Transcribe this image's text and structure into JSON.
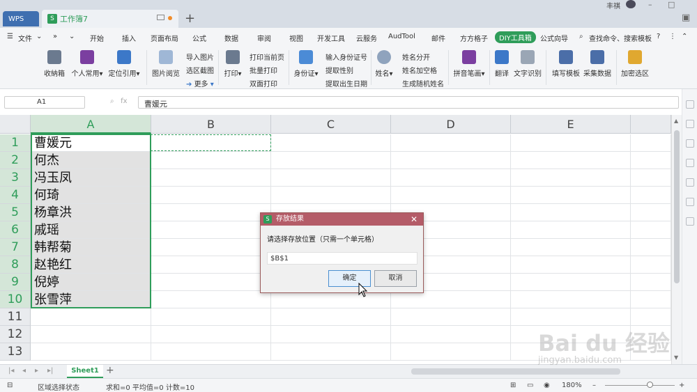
{
  "tabbar": {
    "app_tab": "WPS",
    "doc_tab": "工作簿7",
    "user": "丰祺"
  },
  "menu": [
    "文件",
    "开始",
    "插入",
    "页面布局",
    "公式",
    "数据",
    "审阅",
    "视图",
    "开发工具",
    "云服务",
    "AudTool",
    "邮件",
    "方方格子",
    "DIY工具箱",
    "公式向导"
  ],
  "search": "查找命令、搜索模板",
  "ribbon": {
    "big": [
      {
        "label": "收納箱"
      },
      {
        "label": "个人常用"
      },
      {
        "label": "定位引用"
      },
      {
        "label": "图片阅览"
      },
      {
        "label": "打印"
      },
      {
        "label": "身份证"
      },
      {
        "label": "姓名"
      },
      {
        "label": "拼音笔画"
      },
      {
        "label": "翻译"
      },
      {
        "label": "文字识别"
      },
      {
        "label": "填写模板"
      },
      {
        "label": "采集数据"
      },
      {
        "label": "加密选区"
      }
    ],
    "small": [
      "导入图片",
      "选区截图",
      "更多",
      "打印当前页",
      "批量打印",
      "双面打印",
      "输入身份证号",
      "提取性别",
      "提取出生日期",
      "姓名分开",
      "姓名加空格",
      "生成随机姓名"
    ]
  },
  "formula": {
    "cell_ref": "A1",
    "value": "曹媛元"
  },
  "columns": [
    "A",
    "B",
    "C",
    "D",
    "E"
  ],
  "rows": [
    "1",
    "2",
    "3",
    "4",
    "5",
    "6",
    "7",
    "8",
    "9",
    "10",
    "11",
    "12",
    "13"
  ],
  "names": [
    "曹媛元",
    "何杰",
    "冯玉凤",
    "何琦",
    "杨章洪",
    "戚瑶",
    "韩帮菊",
    "赵艳红",
    "倪婷",
    "张雪萍"
  ],
  "sheet": {
    "tab": "Sheet1"
  },
  "status": {
    "mode": "区域选择状态",
    "stats": "求和=0  平均值=0  计数=10",
    "zoom": "180%"
  },
  "dialog": {
    "title": "存放结果",
    "prompt": "请选择存放位置（只需一个单元格）",
    "value": "$B$1",
    "ok": "确定",
    "cancel": "取消"
  },
  "watermark": {
    "brand": "Bai du 经验",
    "url": "jingyan.baidu.com"
  }
}
